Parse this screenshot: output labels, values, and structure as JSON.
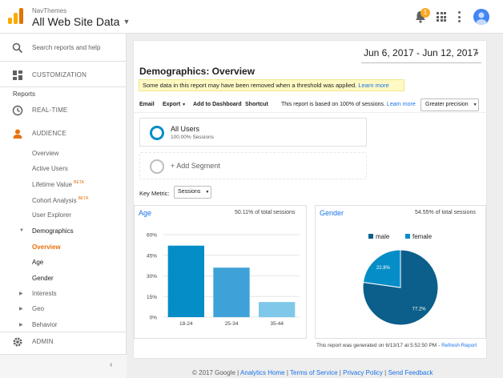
{
  "header": {
    "org": "NavThemes",
    "property": "All Web Site Data",
    "notifications_count": "1"
  },
  "sidebar": {
    "search": "Search reports and help",
    "customization": "CUSTOMIZATION",
    "reports_heading": "Reports",
    "realtime": "REAL-TIME",
    "audience": "AUDIENCE",
    "audience_items": [
      "Overview",
      "Active Users",
      "Lifetime Value",
      "Cohort Analysis",
      "User Explorer",
      "Demographics",
      "Overview",
      "Age",
      "Gender",
      "Interests",
      "Geo",
      "Behavior"
    ],
    "beta": "BETA",
    "admin": "ADMIN"
  },
  "main": {
    "date_range": "Jun 6, 2017 - Jun 12, 2017",
    "title": "Demographics: Overview",
    "notice_text": "Some data in this report may have been removed when a threshold was applied.",
    "notice_link": "Learn more",
    "toolbar": {
      "email": "Email",
      "export": "Export",
      "add_dashboard": "Add to Dashboard",
      "shortcut": "Shortcut",
      "based_on": "This report is based on 100% of sessions.",
      "learn_more": "Learn more",
      "precision": "Greater precision"
    },
    "segment": {
      "name": "All Users",
      "sub": "100.00% Sessions",
      "add": "+ Add Segment"
    },
    "key_metric_label": "Key Metric:",
    "key_metric_value": "Sessions",
    "age_panel": {
      "title": "Age",
      "stat": "50.11% of total sessions"
    },
    "gender_panel": {
      "title": "Gender",
      "stat": "54.55% of total sessions"
    },
    "generated": "This report was generated on 6/13/17 at 5:52:50 PM -",
    "refresh": "Refresh Report"
  },
  "footer": {
    "copyright": "© 2017 Google",
    "links": [
      "Analytics Home",
      "Terms of Service",
      "Privacy Policy",
      "Send Feedback"
    ]
  },
  "colors": {
    "accent": "#e8710a",
    "link": "#1a73e8",
    "bar_dark": "#058dc7",
    "bar_mid": "#3ea2d8",
    "bar_light": "#7fc8ea",
    "male": "#0b5f8a",
    "female": "#058dc7"
  },
  "chart_data": [
    {
      "type": "bar",
      "title": "Age",
      "categories": [
        "18-24",
        "25-34",
        "35-44"
      ],
      "values": [
        52,
        36,
        11
      ],
      "ylim": [
        0,
        60
      ],
      "yticks": [
        "0%",
        "15%",
        "30%",
        "45%",
        "60%"
      ],
      "grid": true
    },
    {
      "type": "pie",
      "title": "Gender",
      "series": [
        {
          "name": "male",
          "values": [
            77.2
          ]
        },
        {
          "name": "female",
          "values": [
            22.8
          ]
        }
      ],
      "labels": [
        "77.2%",
        "22.8%"
      ],
      "legend": "top"
    }
  ]
}
